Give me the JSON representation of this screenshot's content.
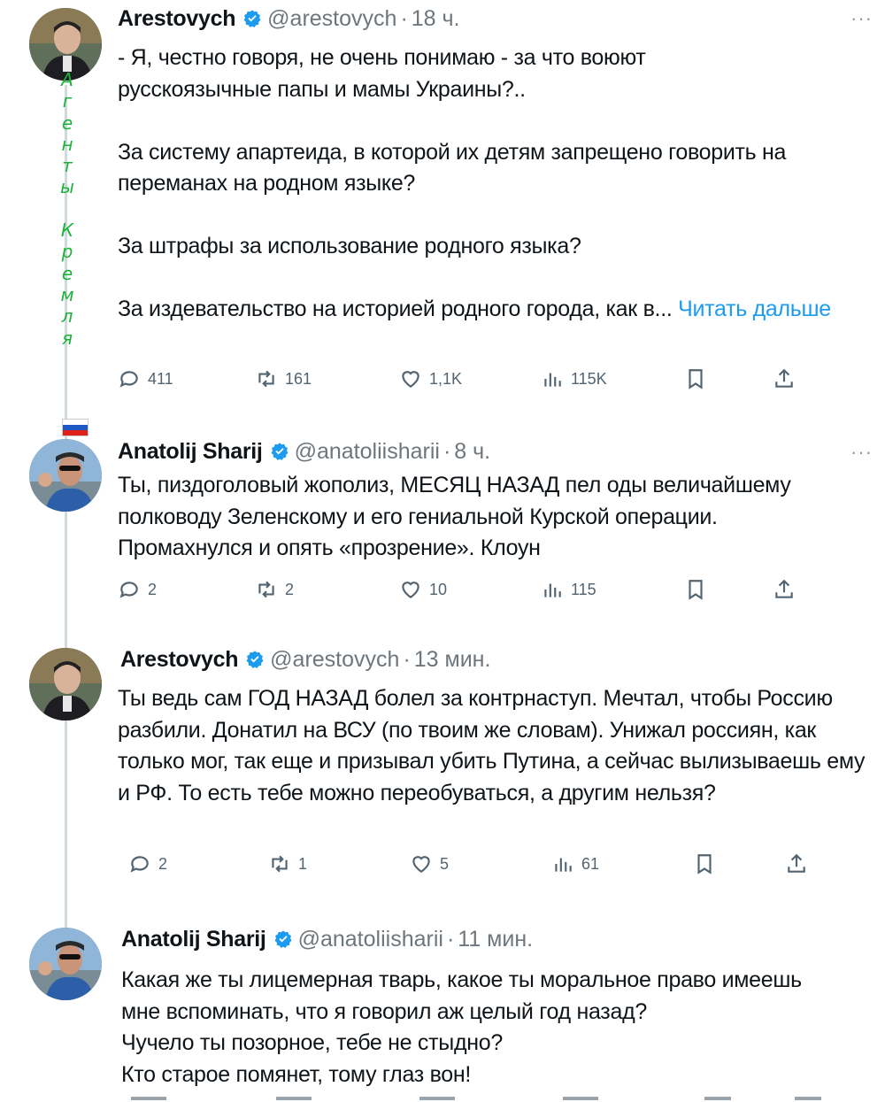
{
  "tweets": [
    {
      "name": "Arestovych",
      "handle": "@arestovych",
      "time": "18 ч.",
      "more": "···",
      "paragraphs": [
        "- Я, честно говоря, не очень понимаю - за что воюют русскоязычные папы и мамы Украины?..",
        "За систему апартеида, в которой их детям запрещено говорить на переманах на родном языке?",
        "За штрафы за использование родного языка?",
        "За издевательство на историей родного города, как в..."
      ],
      "read_more": "Читать дальше",
      "replies": "411",
      "reposts": "161",
      "likes": "1,1K",
      "views": "115K"
    },
    {
      "name": "Anatolij Sharij",
      "handle": "@anatoliisharii",
      "time": "8 ч.",
      "more": "···",
      "text": "Ты, пиздоголовый жополиз, МЕСЯЦ НАЗАД пел оды величайшему полководу Зеленскому и его гениальной Курской операции. Промахнулся и опять «прозрение». Клоун",
      "replies": "2",
      "reposts": "2",
      "likes": "10",
      "views": "115"
    },
    {
      "name": "Arestovych",
      "handle": "@arestovych",
      "time": "13 мин.",
      "text": "Ты ведь сам ГОД НАЗАД болел за контрнаступ. Мечтал, чтобы Россию разбили. Донатил на ВСУ (по твоим же словам). Унижал россиян, как только мог, так еще и призывал убить Путина, а сейчас вылизываешь ему и РФ. То есть тебе можно переобуваться, а другим нельзя?",
      "replies": "2",
      "reposts": "1",
      "likes": "5",
      "views": "61"
    },
    {
      "name": "Anatolij Sharij",
      "handle": "@anatoliisharii",
      "time": "11 мин.",
      "lines": [
        "Какая же ты лицемерная тварь, какое ты моральное право имеешь мне вспоминать, что я говорил аж целый год назад?",
        "Чучело ты позорное, тебе не стыдно?",
        "Кто старое помянет, тому глаз вон!"
      ]
    }
  ],
  "overlay": {
    "letters": [
      "А",
      "г",
      "е",
      "н",
      "т",
      "ы",
      "",
      "К",
      "р",
      "е",
      "м",
      "л",
      "я"
    ],
    "color": "#1db33a",
    "flag_colors": [
      "#ffffff",
      "#1c57c4",
      "#e0201b"
    ]
  },
  "colors": {
    "text": "#0f1419",
    "secondary": "#6e767d",
    "link": "#1d9bf0",
    "verified": "#1d9bf0",
    "thread_line": "#cfd9de"
  }
}
